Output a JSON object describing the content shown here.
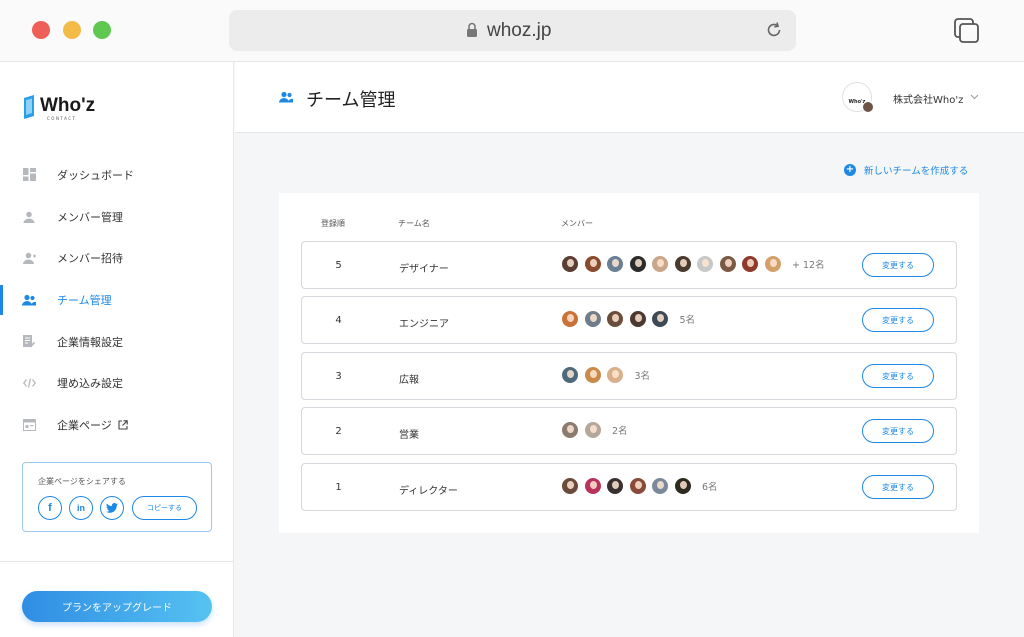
{
  "browser": {
    "url": "whoz.jp"
  },
  "sidebar": {
    "logo_text": "Who'z",
    "logo_sub": "CONTACT",
    "items": [
      {
        "label": "ダッシュボード",
        "icon": "dashboard-icon"
      },
      {
        "label": "メンバー管理",
        "icon": "person-icon"
      },
      {
        "label": "メンバー招待",
        "icon": "person-add-icon"
      },
      {
        "label": "チーム管理",
        "icon": "team-icon",
        "active": true
      },
      {
        "label": "企業情報設定",
        "icon": "edit-document-icon"
      },
      {
        "label": "埋め込み設定",
        "icon": "code-icon"
      },
      {
        "label": "企業ページ",
        "icon": "company-page-icon",
        "external": true
      }
    ],
    "share": {
      "title": "企業ページをシェアする",
      "facebook": "f",
      "linkedin": "in",
      "copy_label": "コピーする"
    },
    "upgrade_label": "プランをアップグレード"
  },
  "header": {
    "title": "チーム管理",
    "company_logo_text": "Who'z",
    "company_name": "株式会社Who'z"
  },
  "actions": {
    "new_team_label": "新しいチームを作成する"
  },
  "table": {
    "columns": [
      "登録順",
      "チーム名",
      "メンバー"
    ],
    "edit_label": "変更する",
    "rows": [
      {
        "order": "5",
        "name": "デザイナー",
        "count_label": "+ 12名",
        "avatar_colors": [
          "#5a3d33",
          "#8a4a2e",
          "#6b7f94",
          "#2b2b2b",
          "#c9a68a",
          "#4a3a2e",
          "#c8c8c8",
          "#7a5a44",
          "#8e3b2c",
          "#d4a06a"
        ]
      },
      {
        "order": "4",
        "name": "エンジニア",
        "count_label": "5名",
        "avatar_colors": [
          "#c9723a",
          "#6f7d8a",
          "#6a4d3b",
          "#4c3a30",
          "#3d4a55"
        ]
      },
      {
        "order": "3",
        "name": "広報",
        "count_label": "3名",
        "avatar_colors": [
          "#4d6a7d",
          "#c98a4a",
          "#d8b08c"
        ]
      },
      {
        "order": "2",
        "name": "営業",
        "count_label": "2名",
        "avatar_colors": [
          "#8a7a70",
          "#b5a89a"
        ]
      },
      {
        "order": "1",
        "name": "ディレクター",
        "count_label": "6名",
        "avatar_colors": [
          "#6a4a3a",
          "#b8325a",
          "#3a3030",
          "#8a4a3a",
          "#7a8a9a",
          "#2f2a20"
        ]
      }
    ]
  },
  "colors": {
    "accent": "#1e88e5"
  }
}
